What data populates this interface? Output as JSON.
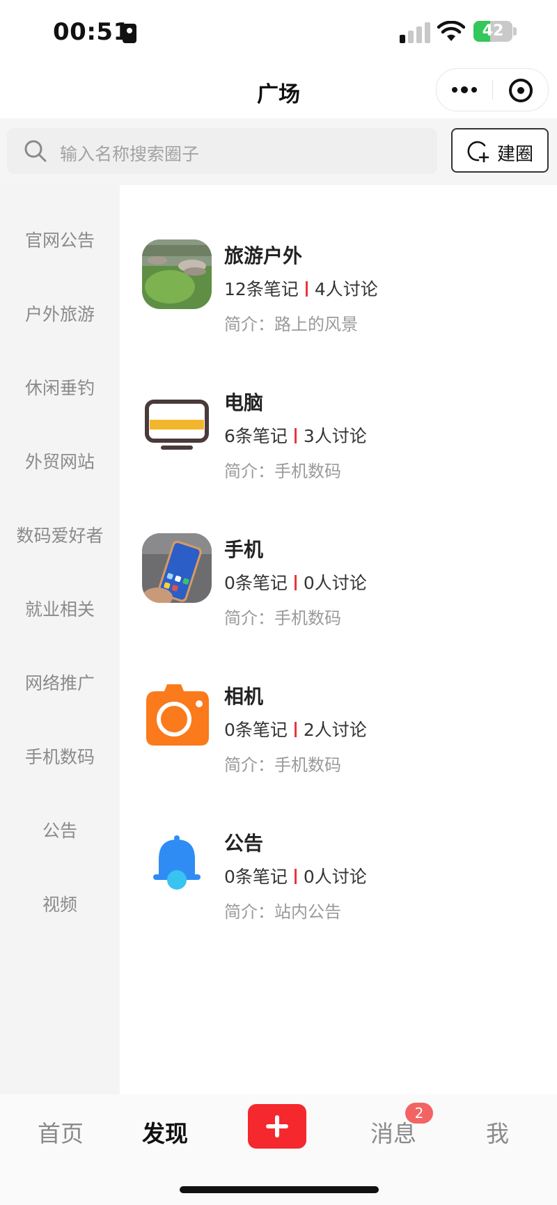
{
  "status_bar": {
    "time": "00:51",
    "battery_level": "42",
    "battery_fraction": 0.42
  },
  "nav": {
    "title": "广场"
  },
  "search": {
    "placeholder": "输入名称搜索圈子",
    "create_label": "建圈"
  },
  "sidebar": {
    "items": [
      {
        "label": "官网公告"
      },
      {
        "label": "户外旅游"
      },
      {
        "label": "休闲垂钓"
      },
      {
        "label": "外贸网站"
      },
      {
        "label": "数码爱好者"
      },
      {
        "label": "就业相关"
      },
      {
        "label": "网络推广"
      },
      {
        "label": "手机数码"
      },
      {
        "label": "公告"
      },
      {
        "label": "视频"
      }
    ]
  },
  "circles": [
    {
      "name": "旅游户外",
      "notes": "12条笔记",
      "discussions": "4人讨论",
      "intro": "简介：路上的风景",
      "thumb": "landscape-photo"
    },
    {
      "name": "电脑",
      "notes": "6条笔记",
      "discussions": "3人讨论",
      "intro": "简介：手机数码",
      "thumb": "monitor-icon"
    },
    {
      "name": "手机",
      "notes": "0条笔记",
      "discussions": "0人讨论",
      "intro": "简介：手机数码",
      "thumb": "phone-photo"
    },
    {
      "name": "相机",
      "notes": "0条笔记",
      "discussions": "2人讨论",
      "intro": "简介：手机数码",
      "thumb": "camera-icon"
    },
    {
      "name": "公告",
      "notes": "0条笔记",
      "discussions": "0人讨论",
      "intro": "简介：站内公告",
      "thumb": "bell-icon"
    }
  ],
  "tabbar": {
    "home": "首页",
    "discover": "发现",
    "messages": "消息",
    "messages_badge": "2",
    "me": "我"
  },
  "colors": {
    "accent": "#f5282d",
    "separator": "#e8363e",
    "camera": "#fa7a1c",
    "bell": "#2f8cf5",
    "monitor_bar": "#f2b62c"
  }
}
